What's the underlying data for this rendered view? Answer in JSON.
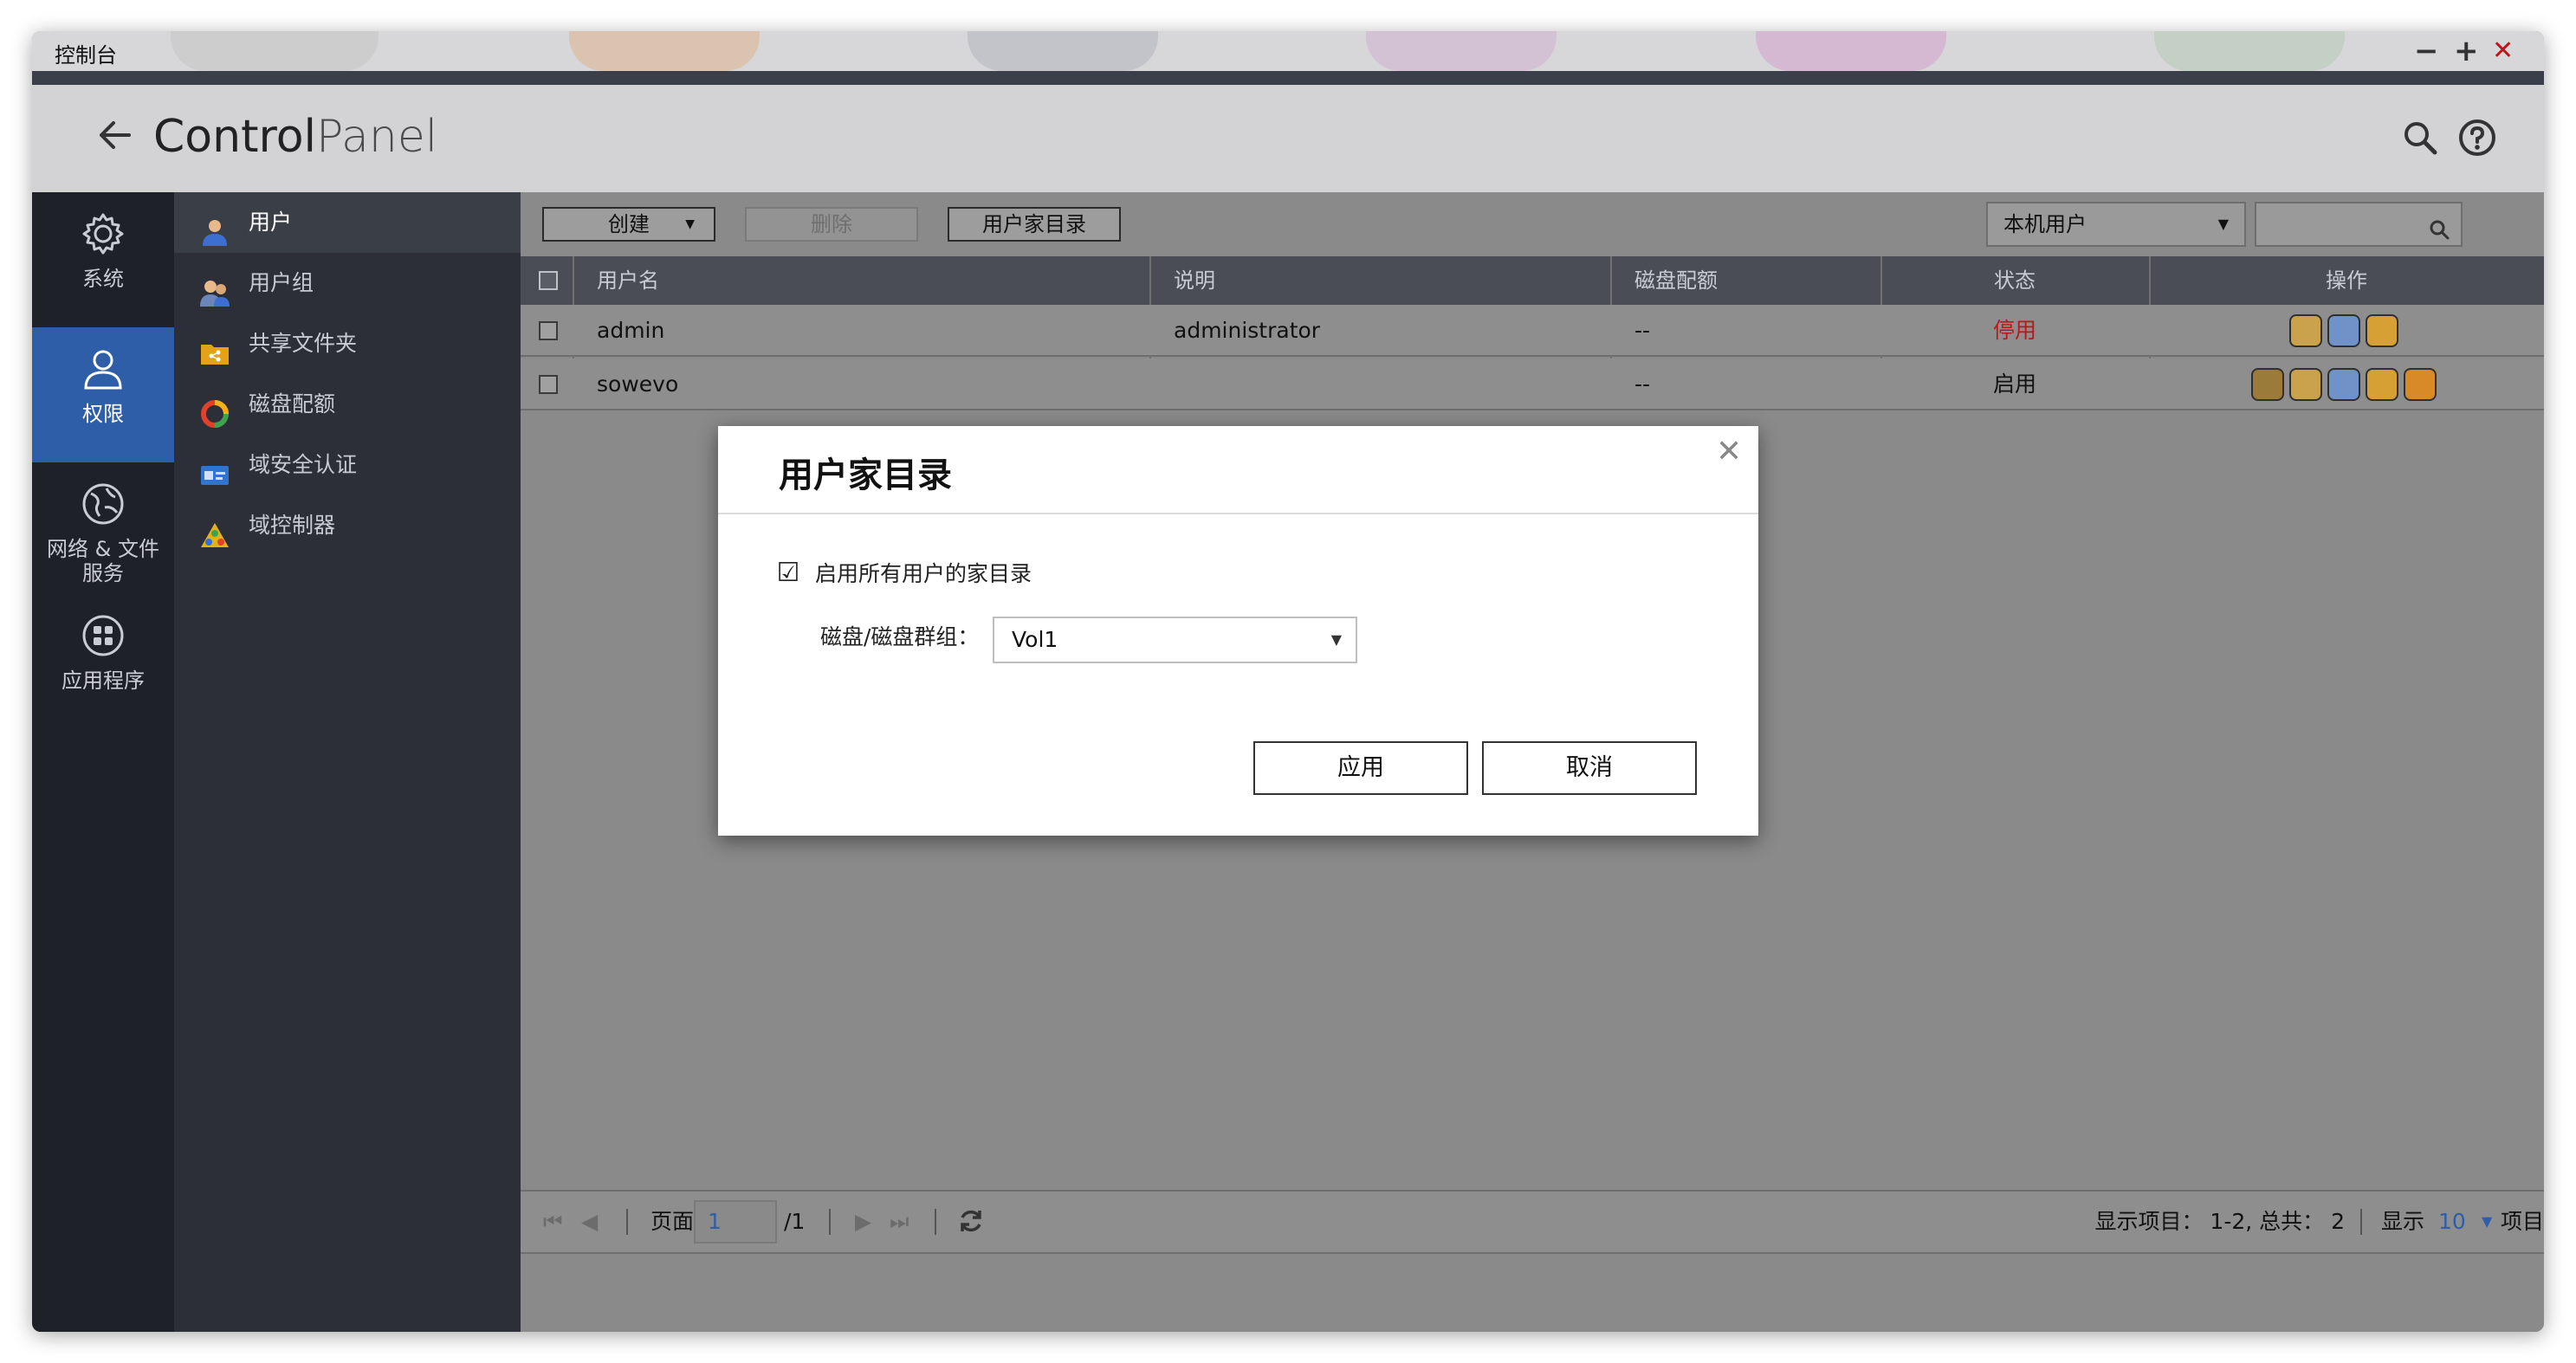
{
  "window": {
    "title": "控制台",
    "controls": {
      "minimize": "−",
      "maximize": "+",
      "close": "✕"
    }
  },
  "header": {
    "title_bold": "Control",
    "title_thin": "Panel"
  },
  "nav_primary": [
    {
      "label": "系统",
      "icon": "gear-icon"
    },
    {
      "label": "权限",
      "icon": "user-icon",
      "active": true
    },
    {
      "label_line1": "网络 & 文件",
      "label_line2": "服务",
      "icon": "globe-icon"
    },
    {
      "label": "应用程序",
      "icon": "apps-icon"
    }
  ],
  "nav_secondary": [
    {
      "label": "用户",
      "icon": "user-icon",
      "active": true
    },
    {
      "label": "用户组",
      "icon": "user-group-icon"
    },
    {
      "label": "共享文件夹",
      "icon": "shared-folder-icon"
    },
    {
      "label": "磁盘配额",
      "icon": "disk-quota-icon"
    },
    {
      "label": "域安全认证",
      "icon": "domain-security-icon"
    },
    {
      "label": "域控制器",
      "icon": "domain-controller-icon"
    }
  ],
  "toolbar": {
    "create_label": "创建",
    "delete_label": "删除",
    "home_folder_label": "用户家目录",
    "user_type_selected": "本机用户",
    "search_placeholder": ""
  },
  "table": {
    "columns": [
      "用户名",
      "说明",
      "磁盘配额",
      "状态",
      "操作"
    ],
    "rows": [
      {
        "username": "admin",
        "description": "administrator",
        "quota": "--",
        "status": "停用"
      },
      {
        "username": "sowevo",
        "description": "",
        "quota": "--",
        "status": "启用"
      }
    ]
  },
  "pager": {
    "page_label": "页面",
    "page_value": "1",
    "page_total": "/1",
    "display_items": "显示项目： 1-2, 总共： 2",
    "show_label": "显示",
    "per_page": "10",
    "items_label": "项目"
  },
  "dialog": {
    "title": "用户家目录",
    "enable_checkbox_label": "启用所有用户的家目录",
    "enable_checked_mark": "☑",
    "volume_label": "磁盘/磁盘群组：",
    "volume_selected": "Vol1",
    "apply_label": "应用",
    "cancel_label": "取消"
  },
  "colors": {
    "accent_nav": "#2f5ea8",
    "status_disabled": "#c0141b"
  }
}
